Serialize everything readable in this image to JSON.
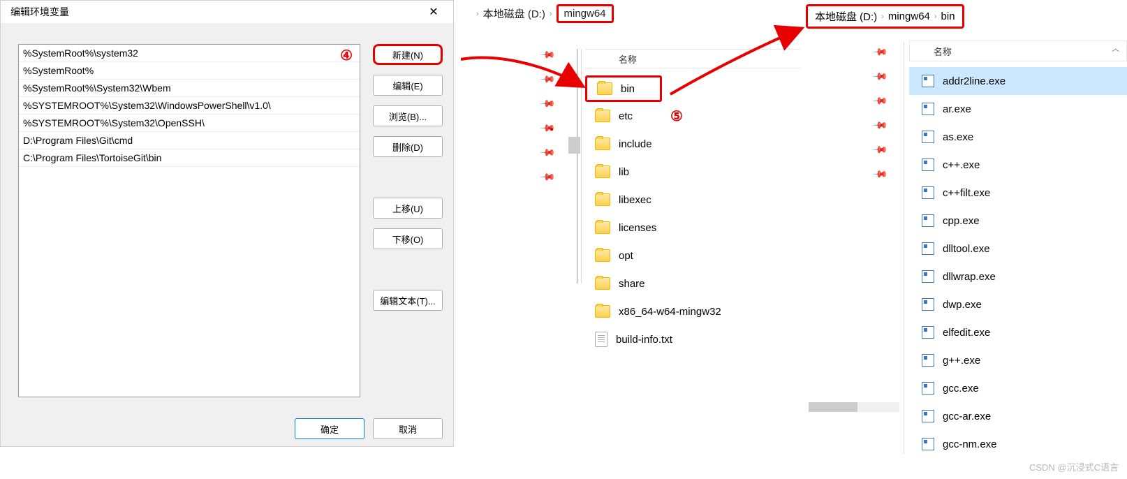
{
  "dialog": {
    "title": "编辑环境变量",
    "close": "✕",
    "entries": [
      "%SystemRoot%\\system32",
      "%SystemRoot%",
      "%SystemRoot%\\System32\\Wbem",
      "%SYSTEMROOT%\\System32\\WindowsPowerShell\\v1.0\\",
      "%SYSTEMROOT%\\System32\\OpenSSH\\",
      "D:\\Program Files\\Git\\cmd",
      "C:\\Program Files\\TortoiseGit\\bin"
    ],
    "marker4": "④",
    "buttons": {
      "new": "新建(N)",
      "edit": "编辑(E)",
      "browse": "浏览(B)...",
      "delete": "删除(D)",
      "moveUp": "上移(U)",
      "moveDown": "下移(O)",
      "editText": "编辑文本(T)...",
      "ok": "确定",
      "cancel": "取消"
    }
  },
  "ex1": {
    "bc": {
      "disk": "本地磁盘 (D:)",
      "folder": "mingw64"
    },
    "header": "名称",
    "marker5": "⑤",
    "items": [
      {
        "name": "bin",
        "type": "folder",
        "boxed": true
      },
      {
        "name": "etc",
        "type": "folder"
      },
      {
        "name": "include",
        "type": "folder"
      },
      {
        "name": "lib",
        "type": "folder"
      },
      {
        "name": "libexec",
        "type": "folder"
      },
      {
        "name": "licenses",
        "type": "folder"
      },
      {
        "name": "opt",
        "type": "folder"
      },
      {
        "name": "share",
        "type": "folder"
      },
      {
        "name": "x86_64-w64-mingw32",
        "type": "folder"
      },
      {
        "name": "build-info.txt",
        "type": "txt"
      }
    ]
  },
  "ex2": {
    "bc": {
      "disk": "本地磁盘 (D:)",
      "folder1": "mingw64",
      "folder2": "bin"
    },
    "header": "名称",
    "items": [
      "addr2line.exe",
      "ar.exe",
      "as.exe",
      "c++.exe",
      "c++filt.exe",
      "cpp.exe",
      "dlltool.exe",
      "dllwrap.exe",
      "dwp.exe",
      "elfedit.exe",
      "g++.exe",
      "gcc.exe",
      "gcc-ar.exe",
      "gcc-nm.exe"
    ]
  },
  "watermark": "CSDN @沉浸式C语言"
}
